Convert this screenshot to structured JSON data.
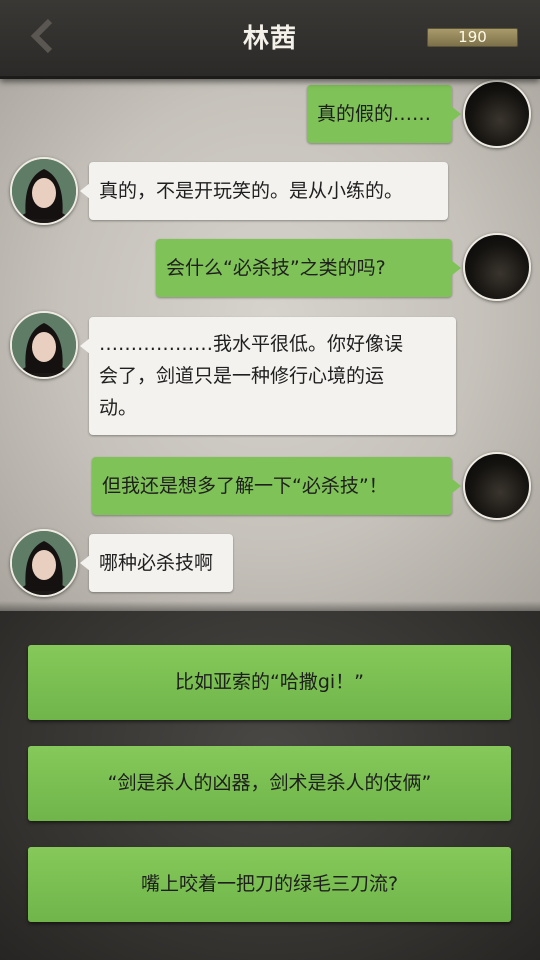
{
  "header": {
    "title": "林茜",
    "score": "190"
  },
  "messages": [
    {
      "from": "player",
      "text": "真的假的……"
    },
    {
      "from": "npc",
      "text": "真的，不是开玩笑的。是从小练的。"
    },
    {
      "from": "player",
      "text": "会什么“必杀技”之类的吗?"
    },
    {
      "from": "npc",
      "lines": [
        "………………我水平很低。你好像误",
        "会了，剑道只是一种修行心境的运",
        "动。"
      ]
    },
    {
      "from": "player",
      "text": "但我还是想多了解一下“必杀技”！"
    },
    {
      "from": "npc",
      "text": "哪种必杀技啊"
    }
  ],
  "options": [
    {
      "label": "比如亚索的“哈撒gi！”"
    },
    {
      "label": "“剑是杀人的凶器，剑术是杀人的伎俩”"
    },
    {
      "label": "嘴上咬着一把刀的绿毛三刀流?"
    }
  ],
  "colors": {
    "player_bubble": "#7fc257",
    "npc_bubble": "#f3f2ee",
    "option_button": "#7cbf52",
    "header_bg": "#33312e"
  },
  "icons": {
    "back": "chevron-left-icon"
  }
}
